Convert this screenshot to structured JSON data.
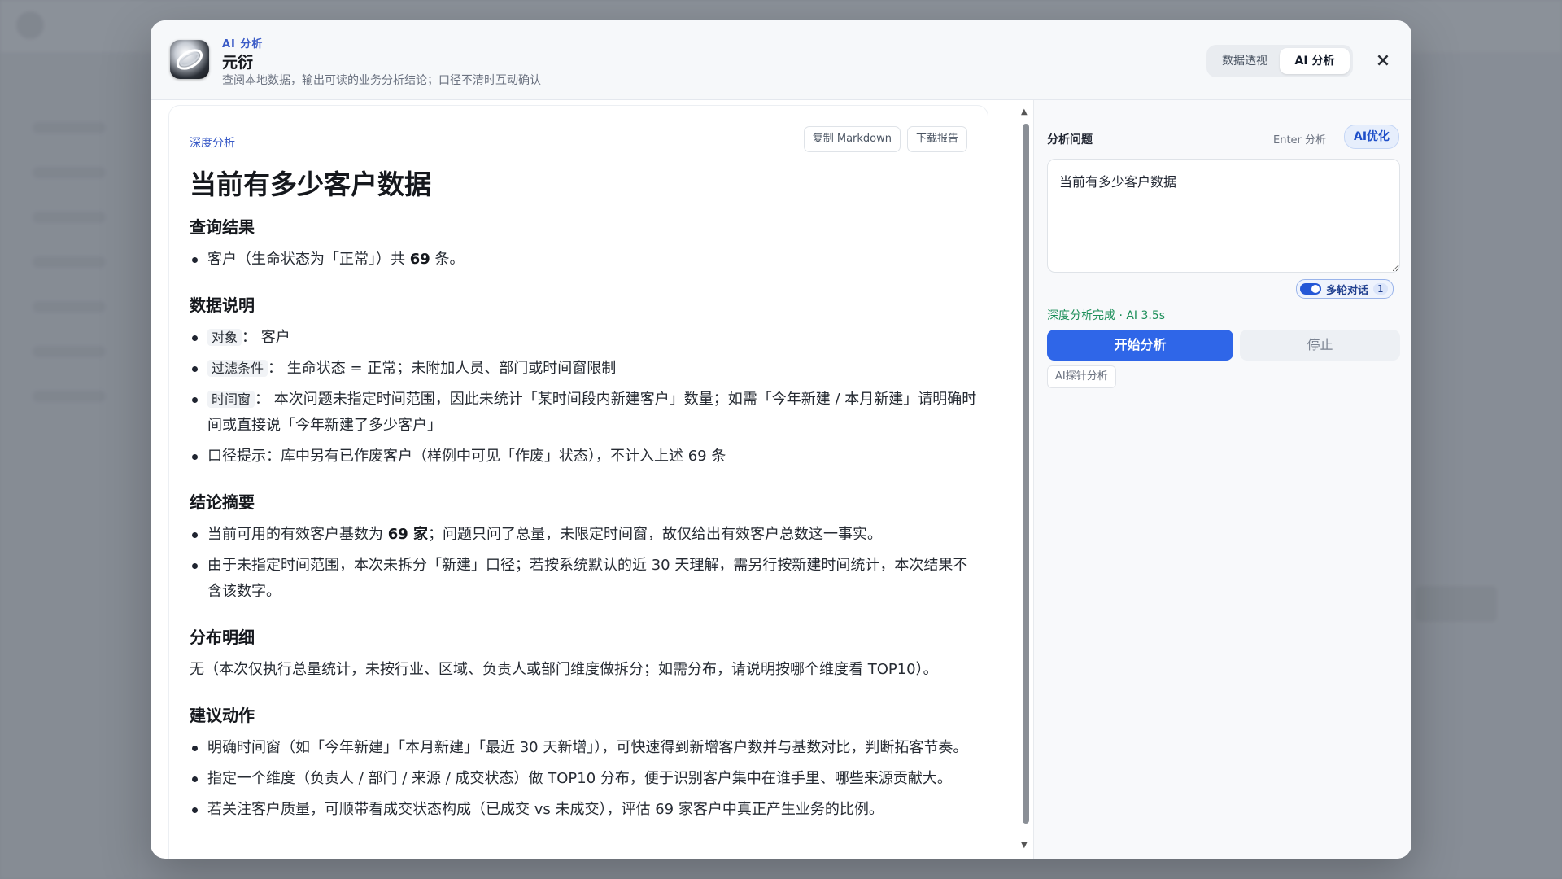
{
  "header": {
    "tag": "AI 分析",
    "title": "元衍",
    "subtitle": "查阅本地数据，输出可读的业务分析结论；口径不清时互动确认",
    "tabs": [
      {
        "label": "数据透视",
        "active": false
      },
      {
        "label": "AI 分析",
        "active": true
      }
    ],
    "close_icon": "close-icon",
    "close_glyph": "×"
  },
  "report": {
    "tag": "深度分析",
    "copy_label": "复制 Markdown",
    "download_label": "下载报告",
    "title": "当前有多少客户数据",
    "sections": {
      "query": {
        "heading": "查询结果",
        "item_1": {
          "pre": "客户（生命状态为「正常」）共 ",
          "bold": "69",
          "post": " 条。"
        }
      },
      "notes": {
        "heading": "数据说明",
        "item_1": {
          "code": "对象",
          "text": "： 客户"
        },
        "item_2": {
          "code": "过滤条件",
          "text": "： 生命状态 = 正常；未附加人员、部门或时间窗限制"
        },
        "item_3": {
          "code": "时间窗",
          "text": "： 本次问题未指定时间范围，因此未统计「某时间段内新建客户」数量；如需「今年新建 / 本月新建」请明确时间或直接说「今年新建了多少客户」"
        },
        "item_4": "口径提示：库中另有已作废客户（样例中可见「作废」状态），不计入上述 69 条"
      },
      "summary": {
        "heading": "结论摘要",
        "item_1": {
          "pre": "当前可用的有效客户基数为 ",
          "bold": "69 家",
          "post": "；问题只问了总量，未限定时间窗，故仅给出有效客户总数这一事实。"
        },
        "item_2": "由于未指定时间范围，本次未拆分「新建」口径；若按系统默认的近 30 天理解，需另行按新建时间统计，本次结果不含该数字。"
      },
      "distribution": {
        "heading": "分布明细",
        "text": "无（本次仅执行总量统计，未按行业、区域、负责人或部门维度做拆分；如需分布，请说明按哪个维度看 TOP10）。"
      },
      "actions": {
        "heading": "建议动作",
        "item_1": "明确时间窗（如「今年新建」「本月新建」「最近 30 天新增」），可快速得到新增客户数并与基数对比，判断拓客节奏。",
        "item_2": "指定一个维度（负责人 / 部门 / 来源 / 成交状态）做 TOP10 分布，便于识别客户集中在谁手里、哪些来源贡献大。",
        "item_3": "若关注客户质量，可顺带看成交状态构成（已成交 vs 未成交），评估 69 家客户中真正产生业务的比例。"
      }
    }
  },
  "scrollbar": {
    "up_glyph": "▲",
    "down_glyph": "▼"
  },
  "panel": {
    "label": "分析问题",
    "hint": "Enter 分析",
    "ai_optimize_label": "AI优化",
    "question_value": "当前有多少客户数据",
    "multi_turn_label": "多轮对话",
    "multi_turn_on": true,
    "multi_turn_count": "1",
    "status": "深度分析完成 · AI 3.5s",
    "start_label": "开始分析",
    "stop_label": "停止",
    "probe_label": "AI探针分析"
  },
  "colors": {
    "accent": "#2f66e8",
    "tag_blue": "#3a5bc7",
    "success": "#1d8f5a"
  }
}
